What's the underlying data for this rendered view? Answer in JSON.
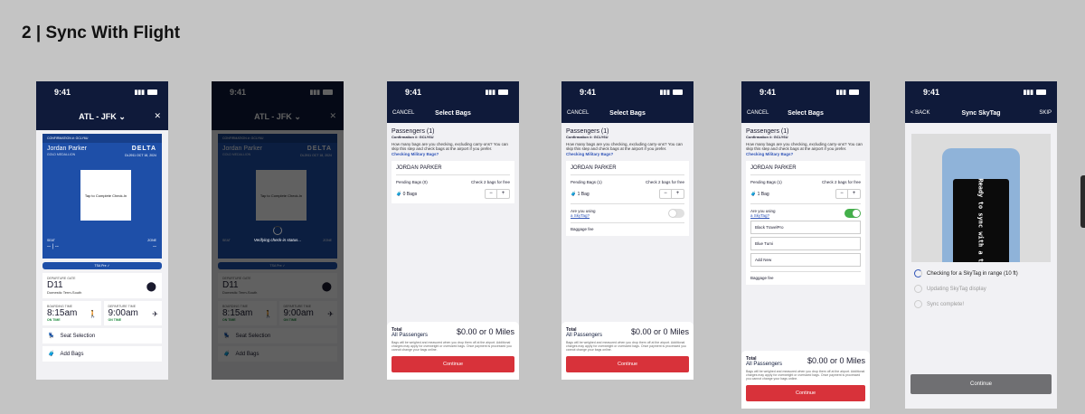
{
  "page_title": "2 | Sync With Flight",
  "status_time": "9:41",
  "status_icons": "..ıl ᯤ",
  "boarding": {
    "route": "ATL - JFK",
    "route_chevron": "⌄",
    "close": "✕",
    "confirmation": "CONFIRMATION #: GCLY6U",
    "name": "Jordan Parker",
    "tier": "GOLD MEDALLION",
    "airline": "DELTA",
    "flight": "DL2911 OCT 18, 2024",
    "qr_text": "Tap to Complete Check-In",
    "seat_label": "SEAT",
    "zone_label": "ZONE",
    "seat_value": "-- | --",
    "zone_value": "--",
    "tsa": "TSA Pre ✓",
    "gate_label": "DEPARTURE GATE",
    "gate_value": "D11",
    "gate_sub": "Domestic Term-South",
    "boarding_label": "BOARDING TIME",
    "boarding_value": "8:15am",
    "departure_label": "DEPARTURE TIME",
    "departure_value": "9:00am",
    "on_time": "ON TIME",
    "seat_selection": "Seat Selection",
    "add_bags": "Add Bags",
    "verifying": "Verifying check-in status..."
  },
  "bags": {
    "cancel": "CANCEL",
    "title": "Select Bags",
    "passengers": "Passengers (1)",
    "confirmation": "Confirmation #: GCLY6U",
    "description": "How many bags are you checking, excluding carry-ons? You can skip this step and check bags at the airport if you prefer.",
    "military": "Checking Military Bags?",
    "passenger_name": "JORDAN PARKER",
    "pending_0": "Pending Bags (0)",
    "pending_1": "Pending Bags (1)",
    "free": "Check 2 bags for free",
    "bags_0": "0 Bags",
    "bags_1": "1 Bag",
    "minus": "−",
    "plus": "+",
    "skytag_q": "Are you using",
    "skytag_link": "a SkyTag?",
    "baggage_fee": "Baggage fee",
    "options": [
      "Black TravelPro",
      "Blue Tumi",
      "Add New"
    ],
    "total": "Total",
    "all_passengers": "All Passengers",
    "amount": "$0.00 or 0 Miles",
    "fine": "Bags will be weighed and measured when you drop them off at the airport. Additional charges may apply for overweight or oversized bags. Once payment is processed you cannot change your bags online.",
    "continue": "Continue"
  },
  "sync": {
    "back": "< BACK",
    "title": "Sync SkyTag",
    "skip": "SKIP",
    "tag_screen": "Ready to sync with a trip",
    "step1": "Checking for a SkyTag in range (10 ft)",
    "step2": "Updating SkyTag display",
    "step3": "Sync complete!",
    "continue": "Continue"
  }
}
